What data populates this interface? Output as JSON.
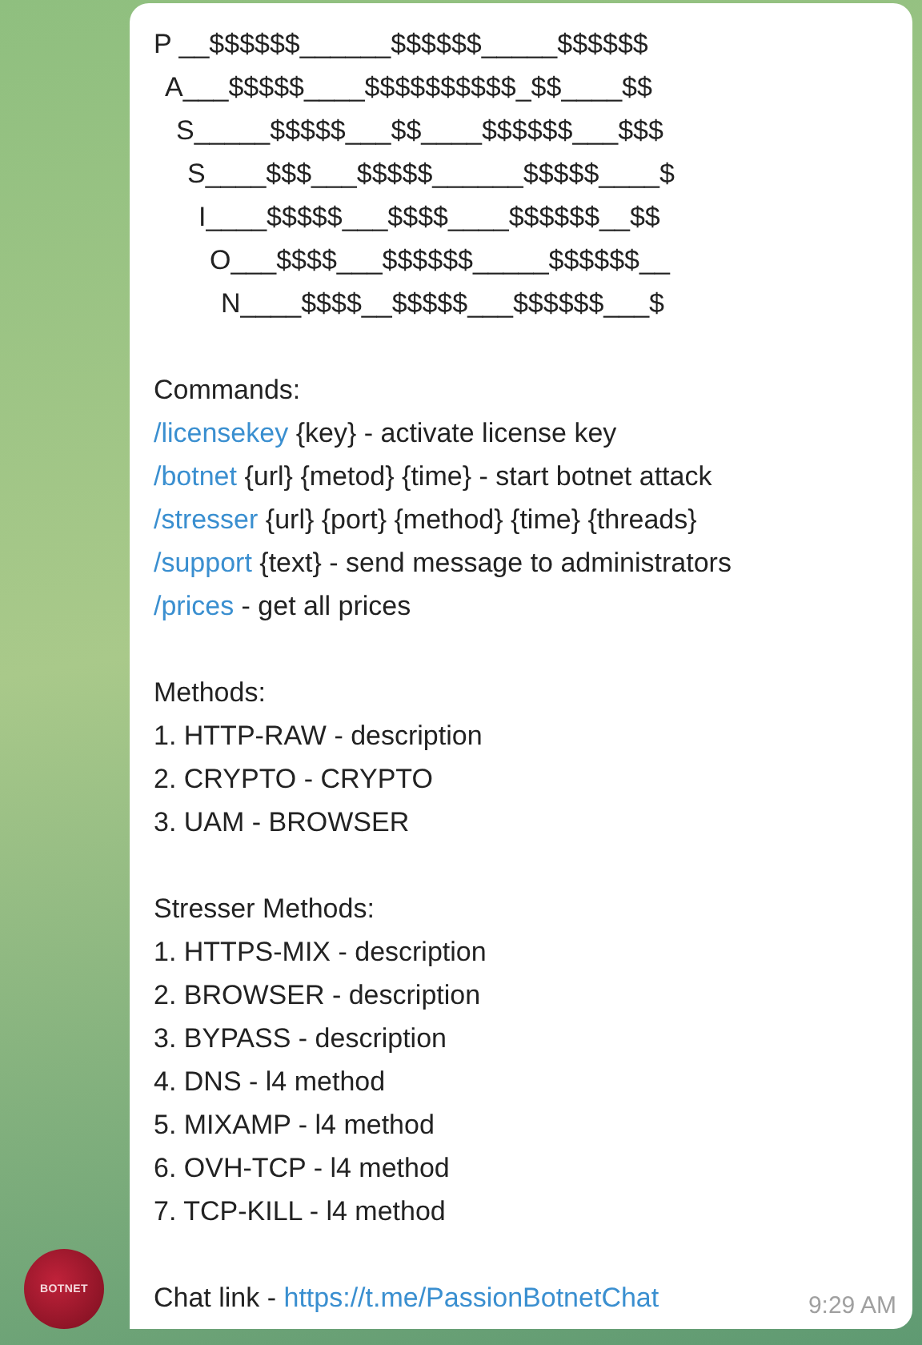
{
  "art_lines": [
    "P __$$$$$$______$$$$$$_____$$$$$$",
    "A___$$$$$____$$$$$$$$$$_$$____$$",
    "S_____$$$$$___$$____$$$$$$___$$$",
    "S____$$$___$$$$$______$$$$$____$",
    "I____$$$$$___$$$$____$$$$$$__$$",
    "O___$$$$___$$$$$$_____$$$$$$__",
    "N____$$$$__$$$$$___$$$$$$___$"
  ],
  "commands": {
    "heading": "Commands:",
    "items": [
      {
        "command": "/licensekey",
        "text": " {key} - activate license key"
      },
      {
        "command": "/botnet",
        "text": " {url} {metod} {time} - start botnet attack"
      },
      {
        "command": "/stresser",
        "text": " {url} {port} {method} {time} {threads}"
      },
      {
        "command": "/support",
        "text": " {text} - send message to administrators"
      },
      {
        "command": "/prices",
        "text": " - get all prices"
      }
    ]
  },
  "methods": {
    "heading": "Methods:",
    "items": [
      "1. HTTP-RAW - description",
      "2. CRYPTO - CRYPTO",
      "3. UAM - BROWSER"
    ]
  },
  "stresser_methods": {
    "heading": "Stresser Methods:",
    "items": [
      "1. HTTPS-MIX - description",
      "2. BROWSER - description",
      "3. BYPASS - description",
      "4. DNS - l4 method",
      "5. MIXAMP - l4 method",
      "6. OVH-TCP - l4 method",
      "7. TCP-KILL - l4 method"
    ]
  },
  "chat_link": {
    "label": "Chat link - ",
    "url": "https://t.me/PassionBotnetChat"
  },
  "time": "9:29 AM",
  "avatar": {
    "label": "BOTNET"
  }
}
